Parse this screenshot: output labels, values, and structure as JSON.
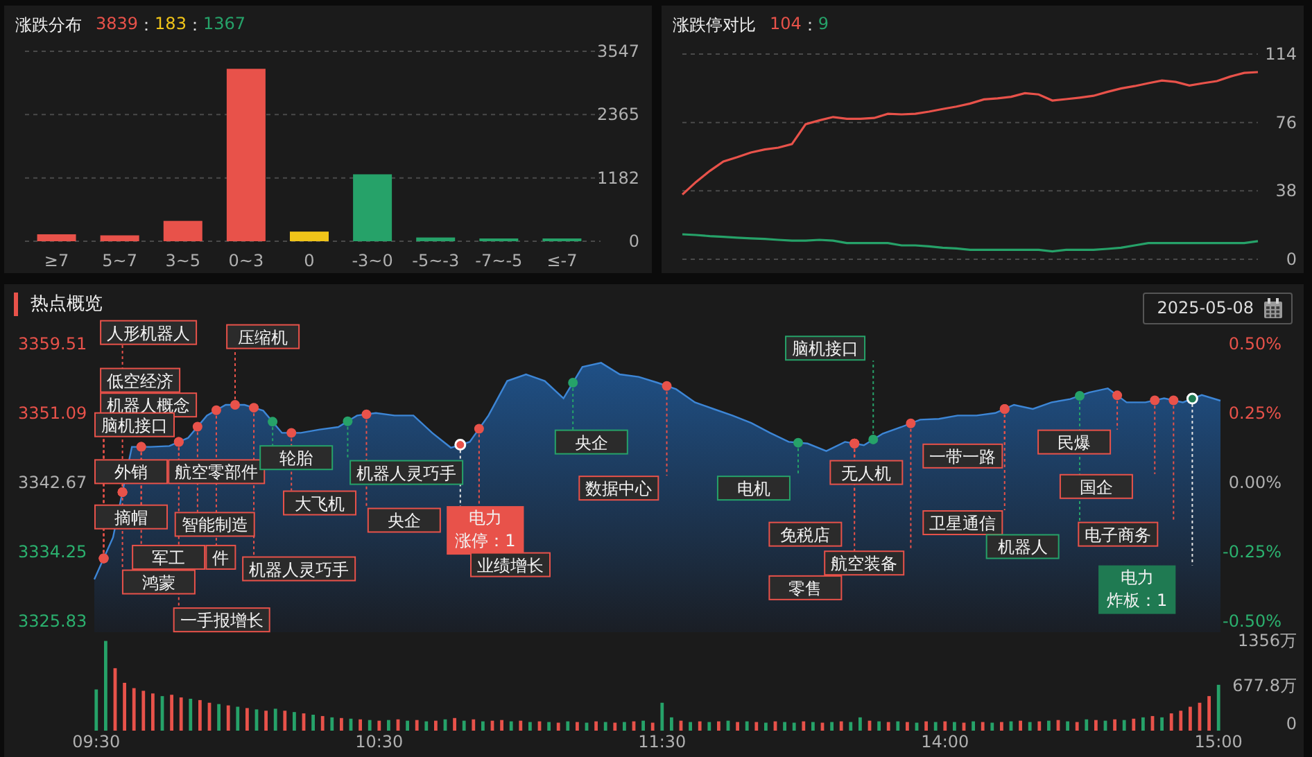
{
  "distribution": {
    "title": "涨跌分布",
    "summary": [
      {
        "text": "3839",
        "color": "#e8524a"
      },
      {
        "text": "：",
        "color": "#dddddd"
      },
      {
        "text": "183",
        "color": "#f0c419"
      },
      {
        "text": "：",
        "color": "#dddddd"
      },
      {
        "text": "1367",
        "color": "#26a269"
      }
    ],
    "chart_data": {
      "type": "bar",
      "categories": [
        "≥7",
        "5~7",
        "3~5",
        "0~3",
        "0",
        "-3~0",
        "-5~-3",
        "-7~-5",
        "≤-7"
      ],
      "stacked": true,
      "ylim": [
        0,
        3547
      ],
      "yticks": [
        0,
        1182,
        2365,
        3547
      ],
      "series": [
        {
          "color": "#e8524a",
          "values": [
            130,
            110,
            380,
            3220,
            null,
            null,
            null,
            null,
            null
          ]
        },
        {
          "color": "#f0c419",
          "values": [
            null,
            null,
            null,
            null,
            180,
            null,
            null,
            null,
            null
          ]
        },
        {
          "color": "#26a269",
          "values": [
            null,
            null,
            null,
            null,
            null,
            1250,
            70,
            30,
            20
          ]
        }
      ]
    }
  },
  "limit_compare": {
    "title": "涨跌停对比",
    "summary": [
      {
        "text": "104",
        "color": "#e8524a"
      },
      {
        "text": "：",
        "color": "#dddddd"
      },
      {
        "text": "9",
        "color": "#26a269"
      }
    ],
    "chart_data": {
      "type": "line",
      "ylim": [
        0,
        114
      ],
      "yticks": [
        0,
        38,
        76,
        114
      ],
      "series": [
        {
          "color": "#e8524a",
          "values": [
            36,
            43,
            49.1,
            54.3,
            56.7,
            59.3,
            61,
            62,
            64,
            75,
            77.2,
            79,
            78,
            78,
            78.5,
            80.8,
            80.5,
            80.8,
            82,
            83.5,
            84.8,
            86.5,
            88.8,
            89.4,
            90.3,
            92.3,
            91.6,
            88.2,
            89,
            89.8,
            90.8,
            93,
            94.9,
            96.2,
            97.8,
            99.3,
            98.5,
            96.5,
            97.8,
            99,
            101.5,
            103.5,
            104
          ]
        },
        {
          "color": "#26a269",
          "values": [
            13.9,
            13.5,
            12.9,
            12.5,
            12,
            11.6,
            11.3,
            10.8,
            10.3,
            10.3,
            10.8,
            10.3,
            9,
            9,
            9,
            9,
            7.7,
            7.7,
            7.2,
            6.4,
            6,
            5.2,
            5.2,
            5.2,
            5.2,
            5.2,
            5.2,
            4.4,
            5.2,
            5.2,
            5.2,
            5.8,
            6.4,
            7.7,
            9,
            9,
            9,
            9,
            9,
            9,
            9,
            9,
            10.1
          ]
        }
      ]
    }
  },
  "hotspots": {
    "title": "热点概览",
    "date": "2025-05-08",
    "tags": [
      {
        "kind": "tag",
        "text": "人形机器人",
        "color": "#e8524a"
      },
      {
        "kind": "tag",
        "text": "压缩机",
        "color": "#e8524a"
      },
      {
        "kind": "tag",
        "text": "低空经济",
        "color": "#e8524a"
      },
      {
        "kind": "tag",
        "text": "机器人概念",
        "color": "#e8524a"
      },
      {
        "kind": "tag",
        "text": "脑机接口",
        "color": "#e8524a"
      },
      {
        "kind": "tag",
        "text": "外销",
        "color": "#e8524a"
      },
      {
        "kind": "tag",
        "text": "航空零部件",
        "color": "#e8524a"
      },
      {
        "kind": "tag",
        "text": "轮胎",
        "color": "#26a269"
      },
      {
        "kind": "tag",
        "text": "机器人灵巧手",
        "color": "#26a269"
      },
      {
        "kind": "tag",
        "text": "摘帽",
        "color": "#e8524a"
      },
      {
        "kind": "tag",
        "text": "智能制造",
        "color": "#e8524a"
      },
      {
        "kind": "tag",
        "text": "大飞机",
        "color": "#e8524a"
      },
      {
        "kind": "tag",
        "text": "央企",
        "color": "#e8524a"
      },
      {
        "kind": "tag",
        "text": "军工",
        "color": "#e8524a"
      },
      {
        "kind": "fragment",
        "text": "件",
        "color": "#e8524a"
      },
      {
        "kind": "tag",
        "text": "鸿蒙",
        "color": "#e8524a"
      },
      {
        "kind": "tag",
        "text": "机器人灵巧手",
        "color": "#e8524a"
      },
      {
        "kind": "tag",
        "text": "一手报增长",
        "color": "#e8524a"
      },
      {
        "kind": "callout",
        "text": "电力",
        "detail": "涨停：1",
        "color": "#e8524a"
      },
      {
        "kind": "tag",
        "text": "业绩增长",
        "color": "#e8524a"
      },
      {
        "kind": "tag",
        "text": "央企",
        "color": "#26a269"
      },
      {
        "kind": "tag",
        "text": "数据中心",
        "color": "#e8524a"
      },
      {
        "kind": "tag",
        "text": "脑机接口",
        "color": "#26a269"
      },
      {
        "kind": "tag",
        "text": "电机",
        "color": "#26a269"
      },
      {
        "kind": "tag",
        "text": "无人机",
        "color": "#e8524a"
      },
      {
        "kind": "tag",
        "text": "免税店",
        "color": "#e8524a"
      },
      {
        "kind": "tag",
        "text": "航空装备",
        "color": "#e8524a"
      },
      {
        "kind": "tag",
        "text": "零售",
        "color": "#e8524a"
      },
      {
        "kind": "tag",
        "text": "一带一路",
        "color": "#e8524a"
      },
      {
        "kind": "tag",
        "text": "卫星通信",
        "color": "#e8524a"
      },
      {
        "kind": "tag",
        "text": "机器人",
        "color": "#26a269"
      },
      {
        "kind": "tag",
        "text": "民爆",
        "color": "#e8524a"
      },
      {
        "kind": "tag",
        "text": "国企",
        "color": "#e8524a"
      },
      {
        "kind": "tag",
        "text": "电子商务",
        "color": "#e8524a"
      },
      {
        "kind": "callout",
        "text": "电力",
        "detail": "炸板：1",
        "color": "#1f7a52"
      }
    ],
    "price_chart": {
      "chart_data": {
        "type": "area",
        "ylim": [
          3325.83,
          3359.51
        ],
        "y2lim": [
          -0.5,
          0.5
        ],
        "yticks": [
          {
            "value": 3359.51,
            "label": "3359.51"
          },
          {
            "value": 3351.09,
            "label": "3351.09"
          },
          {
            "value": 3342.67,
            "label": "3342.67"
          },
          {
            "value": 3334.25,
            "label": "3334.25"
          },
          {
            "value": 3325.83,
            "label": "3325.83"
          }
        ],
        "y2ticks": [
          {
            "value": 0.5,
            "label": "0.50%"
          },
          {
            "value": 0.25,
            "label": "0.25%"
          },
          {
            "value": 0,
            "label": "0.00%"
          },
          {
            "value": -0.25,
            "label": "-0.25%"
          },
          {
            "value": -0.5,
            "label": "-0.50%"
          }
        ],
        "series": [
          {
            "color": "#3d86d6",
            "values": [
              3330.9,
              3336.0,
              3347.0,
              3347.0,
              3347.1,
              3348.1,
              3350.8,
              3352.1,
              3352.1,
              3351.4,
              3348.7,
              3348.7,
              3349.1,
              3349.4,
              3350.8,
              3351.1,
              3350.8,
              3350.8,
              3348.7,
              3346.9,
              3347.6,
              3350.8,
              3355.0,
              3355.8,
              3355.0,
              3352.9,
              3356.7,
              3357.2,
              3355.8,
              3355.5,
              3354.8,
              3354.0,
              3352.4,
              3351.6,
              3350.8,
              3349.9,
              3348.7,
              3347.6,
              3347.4,
              3346.5,
              3347.6,
              3347.2,
              3348.6,
              3349.4,
              3350.3,
              3350.4,
              3350.8,
              3350.8,
              3351.1,
              3352.1,
              3351.6,
              3352.4,
              3352.8,
              3353.6,
              3354.1,
              3352.4,
              3352.4,
              3352.9,
              3352.4,
              3353.3,
              3352.6
            ]
          }
        ]
      }
    },
    "volume_chart": {
      "chart_data": {
        "type": "bar",
        "stacked": true,
        "ylim": [
          0,
          1356
        ],
        "yticks": [
          {
            "value": 0,
            "label": "0"
          },
          {
            "value": 677.8,
            "label": "677.8万"
          },
          {
            "value": 1356,
            "label": "1356万"
          }
        ],
        "categories": [
          "09:30",
          null,
          null,
          null,
          null,
          null,
          null,
          null,
          null,
          null,
          null,
          null,
          null,
          null,
          null,
          null,
          null,
          null,
          null,
          null,
          null,
          null,
          null,
          null,
          null,
          null,
          null,
          null,
          null,
          null,
          "10:30",
          null,
          null,
          null,
          null,
          null,
          null,
          null,
          null,
          null,
          null,
          null,
          null,
          null,
          null,
          null,
          null,
          null,
          null,
          null,
          null,
          null,
          null,
          null,
          null,
          null,
          null,
          null,
          null,
          null,
          "11:30",
          null,
          null,
          null,
          null,
          null,
          null,
          null,
          null,
          null,
          null,
          null,
          null,
          null,
          null,
          null,
          null,
          null,
          null,
          null,
          null,
          null,
          null,
          null,
          null,
          null,
          null,
          null,
          null,
          null,
          "14:00",
          null,
          null,
          null,
          null,
          null,
          null,
          null,
          null,
          null,
          null,
          null,
          null,
          null,
          null,
          null,
          null,
          null,
          null,
          null,
          null,
          null,
          null,
          null,
          null,
          null,
          null,
          null,
          null,
          "15:00"
        ],
        "series": [
          {
            "color": "#e8524a",
            "values": [
              null,
              null,
              940,
              720,
              640,
              600,
              560,
              null,
              540,
              500,
              null,
              460,
              420,
              null,
              380,
              null,
              340,
              null,
              300,
              null,
              300,
              null,
              260,
              null,
              220,
              null,
              190,
              null,
              170,
              null,
              150,
              null,
              170,
              null,
              160,
              null,
              150,
              null,
              190,
              null,
              170,
              null,
              150,
              160,
              null,
              150,
              null,
              140,
              null,
              120,
              null,
              130,
              null,
              140,
              null,
              120,
              null,
              140,
              null,
              120,
              null,
              null,
              150,
              null,
              140,
              null,
              140,
              null,
              130,
              null,
              130,
              null,
              140,
              null,
              null,
              140,
              null,
              120,
              null,
              140,
              null,
              null,
              150,
              null,
              130,
              null,
              130,
              null,
              140,
              null,
              140,
              null,
              120,
              null,
              130,
              null,
              130,
              null,
              150,
              null,
              140,
              null,
              160,
              null,
              130,
              null,
              160,
              null,
              170,
              null,
              180,
              null,
              220,
              null,
              260,
              300,
              360,
              420,
              520,
              null
            ]
          },
          {
            "color": "#26a269",
            "values": [
              620,
              1350,
              null,
              null,
              null,
              null,
              null,
              520,
              null,
              null,
              480,
              null,
              null,
              400,
              null,
              360,
              null,
              320,
              null,
              330,
              null,
              280,
              null,
              240,
              null,
              200,
              null,
              180,
              null,
              160,
              null,
              160,
              null,
              150,
              null,
              140,
              null,
              170,
              null,
              150,
              null,
              140,
              null,
              null,
              140,
              null,
              130,
              null,
              130,
              null,
              140,
              null,
              120,
              null,
              130,
              null,
              130,
              null,
              150,
              null,
              420,
              200,
              null,
              130,
              null,
              130,
              null,
              150,
              null,
              140,
              null,
              120,
              null,
              130,
              120,
              null,
              130,
              null,
              130,
              null,
              130,
              200,
              null,
              140,
              null,
              140,
              null,
              120,
              null,
              130,
              null,
              130,
              null,
              140,
              null,
              120,
              null,
              140,
              null,
              130,
              null,
              150,
              null,
              140,
              null,
              170,
              null,
              150,
              null,
              160,
              null,
              200,
              null,
              200,
              null,
              null,
              null,
              null,
              null,
              690
            ]
          }
        ]
      }
    }
  }
}
